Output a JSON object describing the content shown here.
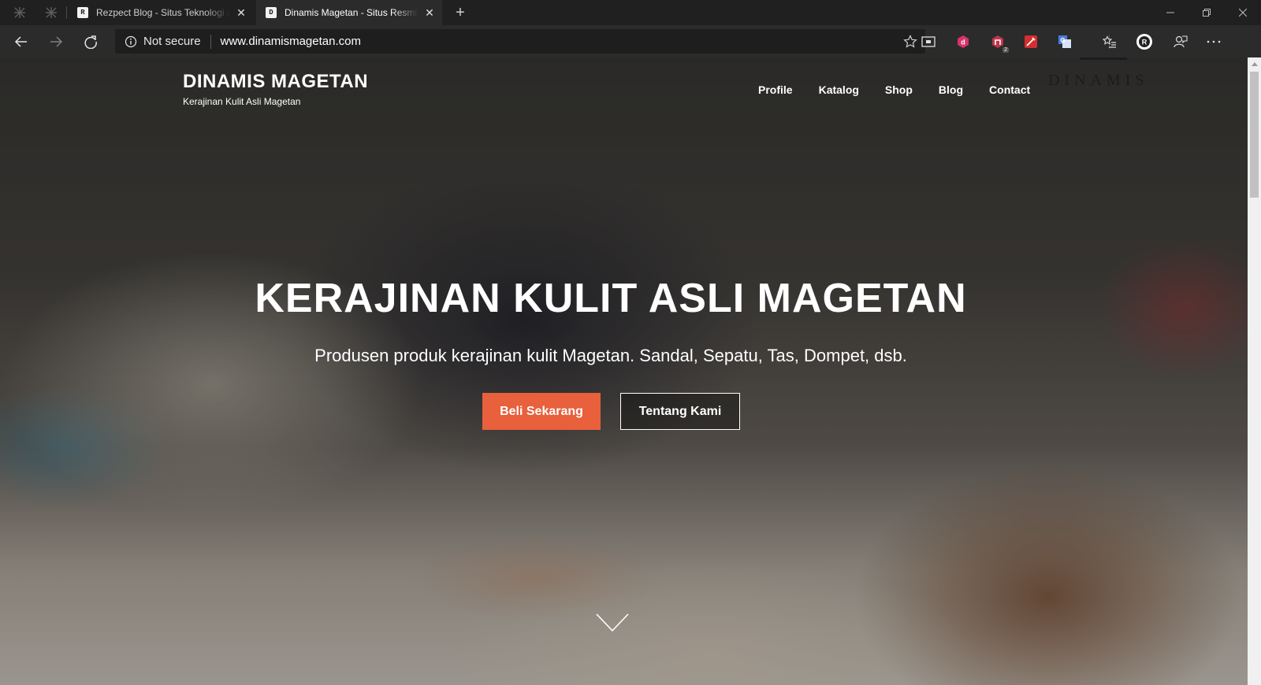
{
  "browser": {
    "tabs": [
      {
        "title": "Rezpect Blog - Situs Teknologi &",
        "favicon": "R",
        "active": false
      },
      {
        "title": "Dinamis Magetan - Situs Resmi K",
        "favicon": "D",
        "active": true
      }
    ],
    "address": {
      "security_label": "Not secure",
      "url": "www.dinamismagetan.com"
    },
    "extensions": [
      {
        "name": "d-extension-icon",
        "color": "#d6336c"
      },
      {
        "name": "shield-extension-icon",
        "color": "#c0364a",
        "badge": "2"
      },
      {
        "name": "pen-extension-icon",
        "color": "#d32f2f"
      },
      {
        "name": "translate-extension-icon",
        "color": "#4a7bd8"
      }
    ]
  },
  "site": {
    "brand_name": "DINAMIS MAGETAN",
    "tagline": "Kerajinan Kulit Asli Magetan",
    "nav": [
      "Profile",
      "Katalog",
      "Shop",
      "Blog",
      "Contact"
    ],
    "logo_text": "DINAMIS",
    "hero_title": "KERAJINAN KULIT ASLI MAGETAN",
    "hero_subtitle": "Produsen produk kerajinan kulit Magetan. Sandal, Sepatu, Tas, Dompet, dsb.",
    "primary_button": "Beli Sekarang",
    "secondary_button": "Tentang Kami",
    "accent_color": "#e8603c"
  }
}
